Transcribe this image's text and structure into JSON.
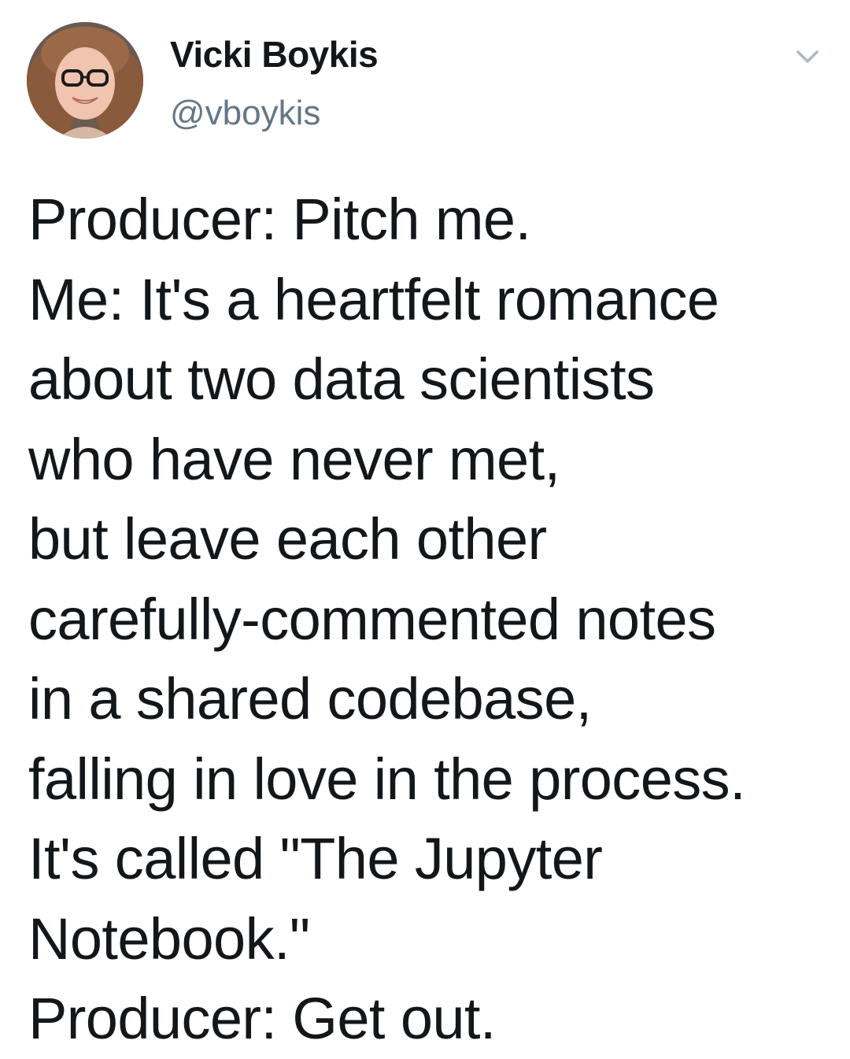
{
  "tweet": {
    "author_name": "Vicki Boykis",
    "author_handle": "@vboykis",
    "lines": [
      "Producer: Pitch me.",
      "Me: It's a heartfelt romance",
      "about two data scientists",
      "who have never met,",
      "but leave each other",
      "carefully-commented notes",
      "in a shared codebase,",
      "falling in love in the process.",
      "It's called \"The Jupyter",
      "Notebook.\"",
      "Producer: Get out."
    ]
  },
  "icons": {
    "menu": "chevron-down-icon",
    "avatar": "profile-photo"
  },
  "colors": {
    "text": "#14171a",
    "handle": "#657786",
    "chevron": "#aab8c2",
    "background": "#ffffff"
  }
}
